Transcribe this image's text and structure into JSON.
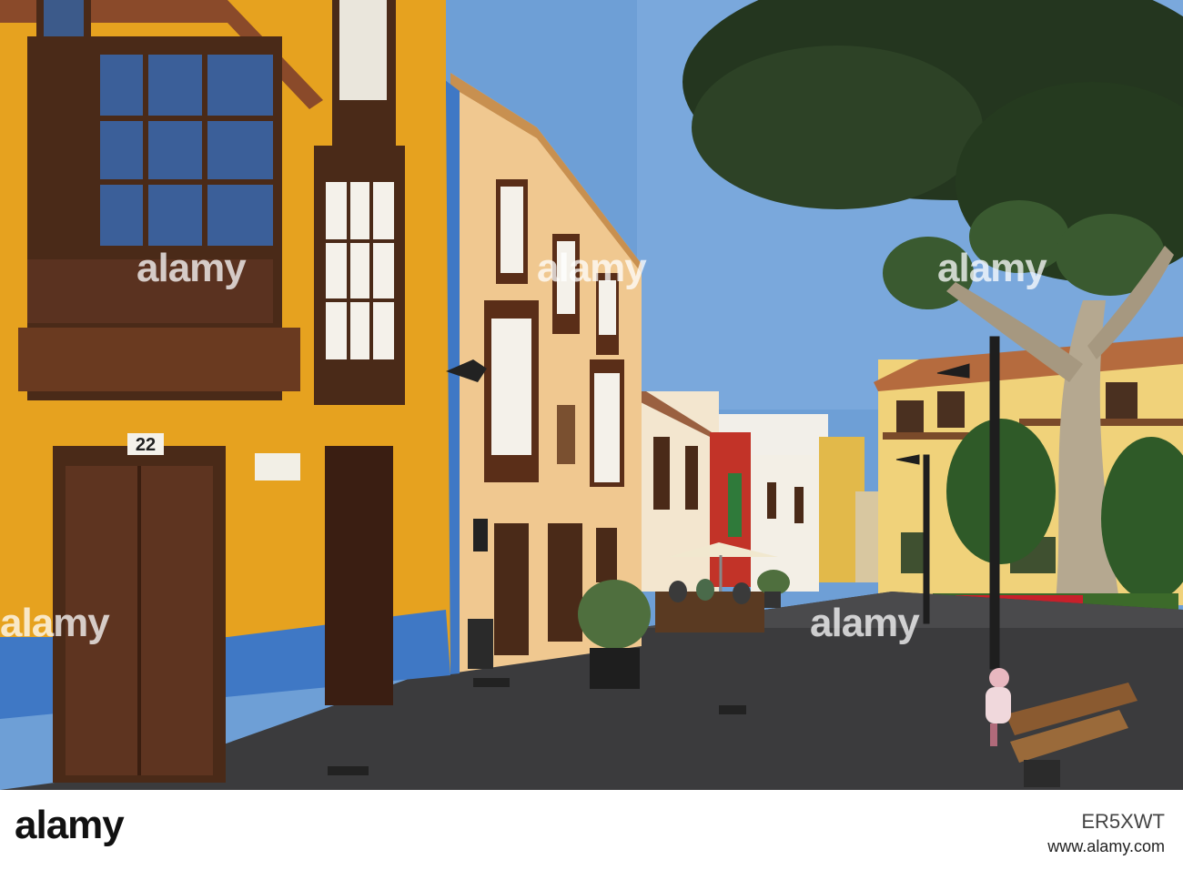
{
  "photo": {
    "house_number": "22",
    "sky_color": "#6e9fd6",
    "facade_yellow": "#e6a21f",
    "facade_cream": "#f0c890",
    "blue_base": "#3f78c5",
    "wood_brown": "#4a2a18"
  },
  "watermarks": [
    "alamy",
    "alamy",
    "alamy",
    "alamy",
    "alamy"
  ],
  "footer": {
    "logo": "alamy",
    "image_code": "ER5XWT",
    "url": "www.alamy.com"
  }
}
